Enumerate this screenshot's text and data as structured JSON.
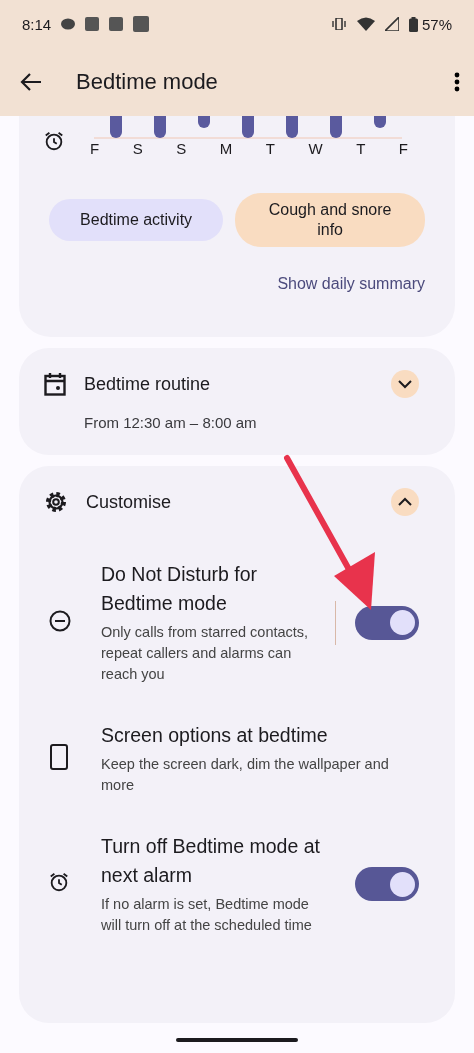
{
  "status_bar": {
    "time": "8:14",
    "battery": "57%"
  },
  "app_bar": {
    "title": "Bedtime mode"
  },
  "sleep_chart": {
    "days": [
      "F",
      "S",
      "S",
      "M",
      "T",
      "W",
      "T",
      "F"
    ]
  },
  "summary": {
    "buttons": [
      {
        "label": "Bedtime activity",
        "kind": "lavender"
      },
      {
        "label": "Cough and snore info",
        "kind": "peach"
      }
    ],
    "link": "Show daily summary"
  },
  "routine": {
    "title": "Bedtime routine",
    "subtitle": "From 12:30 am – 8:00 am",
    "expanded": false
  },
  "customise": {
    "title": "Customise",
    "expanded": true,
    "settings": [
      {
        "kind": "toggle",
        "title": "Do Not Disturb for Bedtime mode",
        "description": "Only calls from starred contacts, repeat callers and alarms can reach you",
        "on": true
      },
      {
        "kind": "link",
        "title": "Screen options at bedtime",
        "description": "Keep the screen dark, dim the wallpaper and more"
      },
      {
        "kind": "toggle",
        "title": "Turn off Bedtime mode at next alarm",
        "description": "If no alarm is set, Bedtime mode will turn off at the scheduled time",
        "on": true
      }
    ]
  }
}
